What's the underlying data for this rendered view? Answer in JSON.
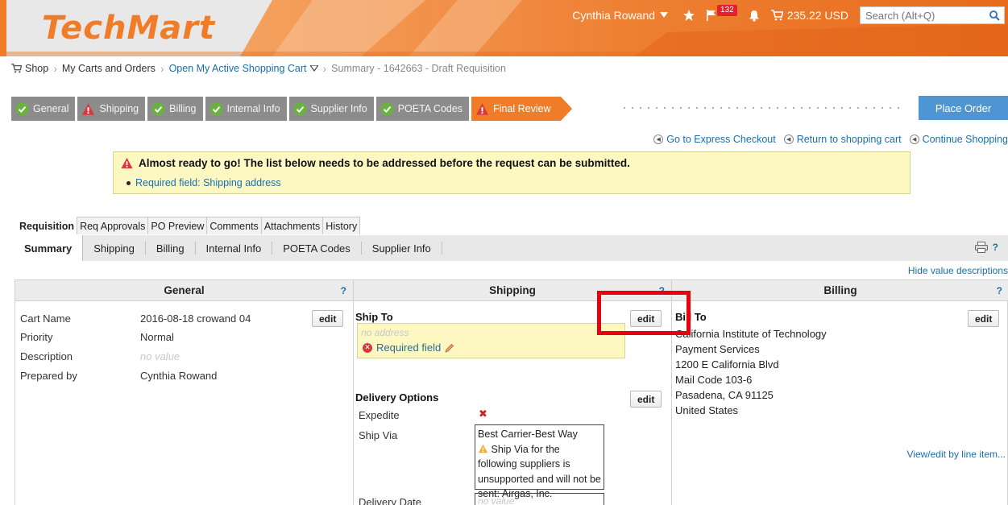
{
  "header": {
    "logo": "TechMart",
    "user": "Cynthia Rowand",
    "flag_count": "132",
    "cart_total": "235.22 USD",
    "search_placeholder": "Search (Alt+Q)"
  },
  "breadcrumb": {
    "shop": "Shop",
    "carts": "My Carts and Orders",
    "active_cart": "Open My Active Shopping Cart",
    "current": "Summary - 1642663 - Draft Requisition"
  },
  "steps": [
    {
      "label": "General",
      "status": "ok"
    },
    {
      "label": "Shipping",
      "status": "warn"
    },
    {
      "label": "Billing",
      "status": "ok"
    },
    {
      "label": "Internal Info",
      "status": "ok"
    },
    {
      "label": "Supplier Info",
      "status": "ok"
    },
    {
      "label": "POETA Codes",
      "status": "ok"
    },
    {
      "label": "Final Review",
      "status": "warn"
    }
  ],
  "place_order": "Place Order",
  "quick_links": {
    "express": "Go to Express Checkout",
    "return_cart": "Return to shopping cart",
    "continue": "Continue Shopping"
  },
  "warning": {
    "title": "Almost ready to go! The list below needs to be addressed before the request can be submitted.",
    "item": "Required field: Shipping address"
  },
  "tabs": [
    "Requisition",
    "Req Approvals",
    "PO Preview",
    "Comments",
    "Attachments",
    "History"
  ],
  "subtabs": [
    "Summary",
    "Shipping",
    "Billing",
    "Internal Info",
    "POETA Codes",
    "Supplier Info"
  ],
  "hide_descriptions": "Hide value descriptions",
  "general": {
    "title": "General",
    "help": "?",
    "edit": "edit",
    "fields": [
      {
        "label": "Cart Name",
        "value": "2016-08-18 crowand 04"
      },
      {
        "label": "Priority",
        "value": "Normal"
      },
      {
        "label": "Description",
        "value": "no value"
      },
      {
        "label": "Prepared by",
        "value": "Cynthia Rowand"
      }
    ]
  },
  "shipping": {
    "title": "Shipping",
    "help": "?",
    "ship_to_title": "Ship To",
    "edit": "edit",
    "no_address": "no address",
    "required_field": "Required field",
    "delivery_title": "Delivery Options",
    "expedite_label": "Expedite",
    "ship_via_label": "Ship Via",
    "ship_via_value": "Best Carrier-Best Way",
    "ship_via_warning": "Ship Via for the following suppliers is unsupported and will not be sent: Airgas, Inc.",
    "delivery_date_label": "Delivery Date",
    "delivery_date_value": "no value"
  },
  "billing": {
    "title": "Billing",
    "help": "?",
    "bill_to_title": "Bill To",
    "edit": "edit",
    "lines": [
      "California Institute of Technology",
      "Payment Services",
      "1200 E California Blvd",
      "Mail Code 103-6",
      "Pasadena, CA 91125",
      "United States"
    ],
    "view_edit": "View/edit by line item..."
  },
  "colors": {
    "brand_orange": "#f07c28",
    "link_blue": "#1a6fa8",
    "warning_yellow": "#fdf8c2",
    "step_gray": "#8c8c8c",
    "place_order_blue": "#4f95d4",
    "highlight_red": "#e8000e"
  }
}
